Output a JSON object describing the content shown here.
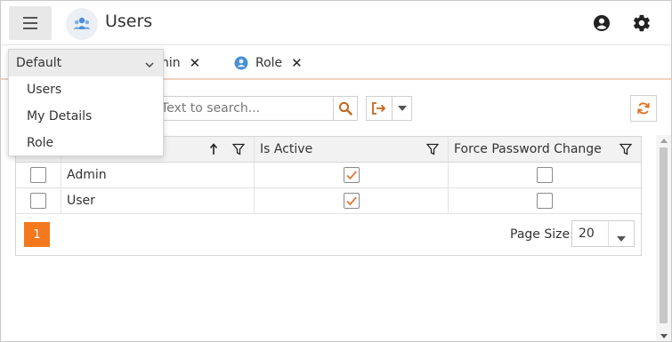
{
  "header": {
    "title": "Users",
    "menu_icon": "hamburger-menu-icon",
    "app_icon": "users-group-icon",
    "account_icon": "account-circle-icon",
    "settings_icon": "gear-icon"
  },
  "tabs": [
    {
      "label": "nin",
      "close": "✕"
    },
    {
      "label": "Role",
      "close": "✕"
    }
  ],
  "dropdown": {
    "selected": "Default",
    "items": [
      "Users",
      "My Details",
      "Role"
    ]
  },
  "toolbar": {
    "search_placeholder": "Text to search..."
  },
  "grid": {
    "columns": [
      "",
      "",
      "Is Active",
      "Force Password Change"
    ],
    "rows": [
      {
        "name": "Admin",
        "is_active": true,
        "force_password_change": false
      },
      {
        "name": "User",
        "is_active": true,
        "force_password_change": false
      }
    ]
  },
  "pager": {
    "current_page": "1",
    "page_size_label": "Page Size:",
    "page_size": "20"
  },
  "colors": {
    "accent": "#f3781e",
    "check": "#e07a3a"
  }
}
